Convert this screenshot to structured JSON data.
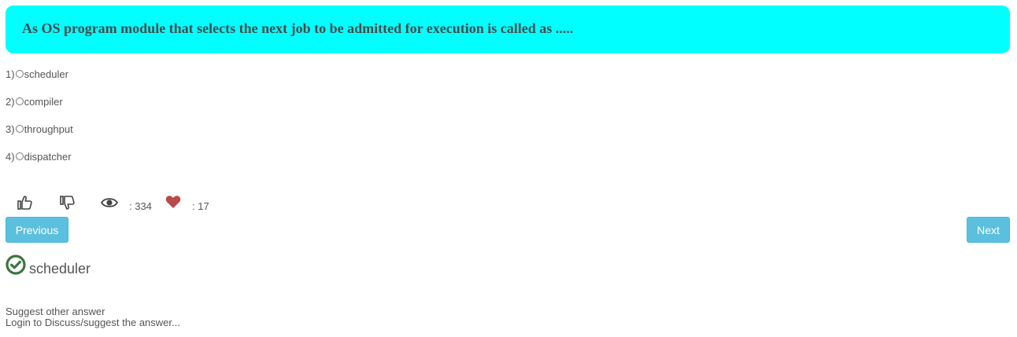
{
  "question": {
    "text": "As OS program module that selects the next job to be admitted for execution is called as ....."
  },
  "options": [
    {
      "num": "1)",
      "label": "scheduler"
    },
    {
      "num": "2)",
      "label": "compiler"
    },
    {
      "num": "3)",
      "label": "throughput"
    },
    {
      "num": "4)",
      "label": "dispatcher"
    }
  ],
  "stats": {
    "like_icon": "thumbs-up-icon",
    "dislike_icon": "thumbs-down-icon",
    "views_icon": "eye-icon",
    "views": ": 334",
    "favorites_icon": "heart-icon",
    "favorites": ": 17",
    "heart_color": "#b94a48"
  },
  "nav": {
    "previous_label": "Previous",
    "next_label": "Next",
    "button_color": "#5bc0de"
  },
  "answer": {
    "icon": "check-circle-icon",
    "icon_color": "#3c763d",
    "text": "scheduler"
  },
  "footer": {
    "suggest_label": "Suggest other answer",
    "login_label": "Login to Discuss/suggest the answer..."
  }
}
